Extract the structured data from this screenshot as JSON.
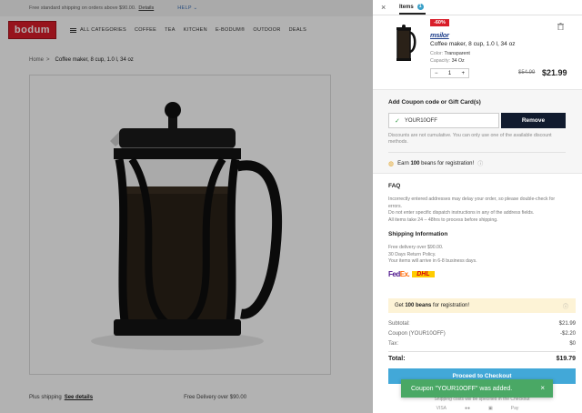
{
  "topbar": {
    "shipping_text": "Free standard shipping on orders above $90.00.",
    "details_link": "Details",
    "help": "HELP ⌄"
  },
  "nav": {
    "logo": "bodum",
    "all_categories": "ALL CATEGORIES",
    "items": [
      "COFFEE",
      "TEA",
      "KITCHEN",
      "E-BODUM®",
      "OUTDOOR",
      "DEALS"
    ]
  },
  "breadcrumb": {
    "home": "Home",
    "sep": ">",
    "current": "Coffee maker, 8 cup, 1.0 l, 34 oz"
  },
  "bottom_strip": {
    "plus_shipping": "Plus shipping",
    "see_details": "See details",
    "free_delivery": "Free Delivery over $90.00"
  },
  "drawer": {
    "close": "×",
    "tab_label": "Items",
    "tab_count": "1",
    "item": {
      "discount_badge": "-60%",
      "brand": "msilor",
      "name": "Coffee maker, 8 cup, 1.0 l, 34 oz",
      "color_label": "Color:",
      "color_value": "Transparent",
      "capacity_label": "Capacity:",
      "capacity_value": "34 Oz",
      "qty_minus": "−",
      "qty_value": "1",
      "qty_plus": "+",
      "old_price": "$54.99",
      "new_price": "$21.99"
    },
    "coupon": {
      "title": "Add Coupon code or Gift Card(s)",
      "code": "YOUR10OFF",
      "remove_label": "Remove",
      "note": "Discounts are not cumulative. You can only use one of the available discount methods.",
      "beans_pre": "Earn",
      "beans_num": "100",
      "beans_post": "beans for registration!",
      "info": "ⓘ"
    },
    "faq": {
      "title": "FAQ",
      "lines": [
        "Incorrectly entered addresses may delay your order, so please double-check for errors.",
        "Do not enter specific dispatch instructions in any of the address fields.",
        "All items take 24 – 48hrs to process before shipping."
      ],
      "shipping_title": "Shipping Information",
      "shipping_lines": [
        "Free delivery over $90.00.",
        "30 Days Return Policy.",
        "Your items will arrive in 6-8 business days."
      ],
      "carrier_fedex_a": "Fed",
      "carrier_fedex_b": "Ex.",
      "carrier_dhl": "DHL"
    },
    "beans_bar": {
      "pre": "Get",
      "num": "100 beans",
      "post": "for registration!",
      "info": "ⓘ"
    },
    "totals": {
      "subtotal_label": "Subtotal:",
      "subtotal_value": "$21.99",
      "coupon_label": "Coupon (YOUR10OFF)",
      "coupon_value": "-$2.20",
      "tax_label": "Tax:",
      "tax_value": "$0",
      "total_label": "Total:",
      "total_value": "$19.79"
    },
    "checkout_label": "Proceed to Checkout",
    "payment_note": "Shipping costs will be specified in the Checkout",
    "payment_icons": [
      "VISA",
      "●●",
      "▣",
      "Pay"
    ]
  },
  "toast": {
    "message": "Coupon \"YOUR10OFF\" was added.",
    "close": "×"
  },
  "colors": {
    "brand_red": "#d91e2a",
    "accent_blue": "#42a8d8",
    "toast_green": "#4aa865",
    "dark_button": "#111b2e"
  }
}
